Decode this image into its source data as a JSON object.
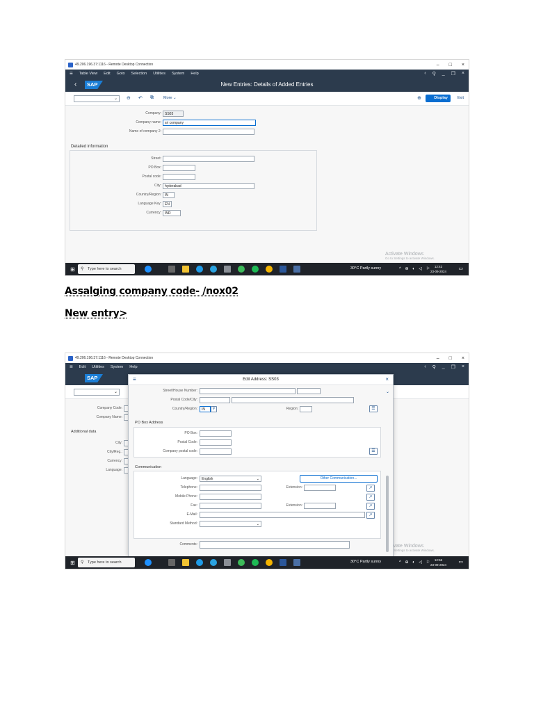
{
  "doc": {
    "heading1": "Assalging company code- /nox02",
    "heading2": "New entry>"
  },
  "rdp": {
    "title": "49.206.196.37:1116 - Remote Desktop Connection",
    "min": "–",
    "max": "□",
    "close": "×"
  },
  "taskbar": {
    "search_placeholder": "Type here to search",
    "weather": "30°C  Partly sunny",
    "time1": "12:42",
    "date1": "23-09-2024",
    "time2": "12:56",
    "date2": "23-09-2024"
  },
  "watermark": {
    "title": "Activate Windows",
    "subtitle": "Go to Settings to activate Windows."
  },
  "screen1": {
    "menu": [
      "Table View",
      "Edit",
      "Goto",
      "Selection",
      "Utilities",
      "System",
      "Help"
    ],
    "logo": "SAP",
    "shell_title": "New Entries: Details of Added Entries",
    "more_label": "More",
    "display_label": "Display",
    "exit_label": "Exit",
    "company_label": "Company:",
    "company_value": "SS03",
    "company_name_label": "Company name:",
    "company_name_value": "sri company",
    "name2_label": "Name of company 2:",
    "name2_value": "",
    "detail_title": "Detailed information",
    "street_label": "Street:",
    "street_value": "",
    "pobox_label": "PO Box:",
    "pobox_value": "",
    "postal_label": "Postal code:",
    "postal_value": "",
    "city_label": "City:",
    "city_value": "hyderabad",
    "country_label": "Country/Region:",
    "country_value": "IN",
    "lang_label": "Language Key:",
    "lang_value": "EN",
    "currency_label": "Currency:",
    "currency_value": "INR"
  },
  "screen2": {
    "menu": [
      "Edit",
      "Utilities",
      "System",
      "Help"
    ],
    "logo": "SAP",
    "bg_company_code_label": "Company Code:",
    "bg_company_name_label": "Company Name:",
    "bg_additional": "Additional data",
    "bg_city_label": "City:",
    "bg_cityreg_label": "City/Reg.:",
    "bg_currency_label": "Currency:",
    "bg_language_label": "Language:",
    "dialog_title": "Edit Address:  SS03",
    "street_house_label": "Street/House Number:",
    "postal_city_label": "Postal Code/City:",
    "country_region_label": "Country/Region:",
    "country_region_value": "IN",
    "region_label": "Region:",
    "pobox_section": "PO Box Address",
    "pobox_label": "PO Box:",
    "pobox_postal_label": "Postal Code:",
    "company_postal_label": "Company postal code:",
    "comm_section": "Communication",
    "language_label": "Language:",
    "language_value": "English",
    "other_comm_label": "Other Communication...",
    "telephone_label": "Telephone:",
    "extension_label": "Extension:",
    "mobile_label": "Mobile Phone:",
    "fax_label": "Fax:",
    "fax_extension_label": "Extension:",
    "email_label": "E-Mail:",
    "std_method_label": "Standard Method:",
    "comments_label": "Comments:"
  }
}
